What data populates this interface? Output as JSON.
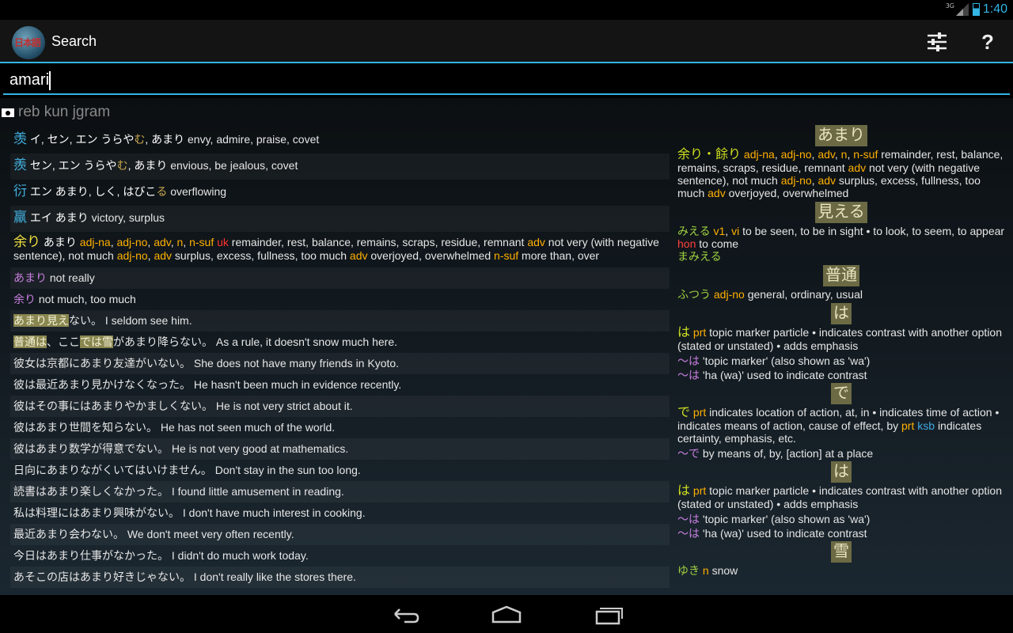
{
  "status": {
    "network": "3G",
    "time": "1:40"
  },
  "app": {
    "logo_text": "日本語",
    "title": "Search",
    "settings_icon": "sliders-icon",
    "help_label": "?"
  },
  "search": {
    "value": "amari"
  },
  "filter": {
    "text": "reb kun jgram"
  },
  "left_rows": {
    "r1": {
      "kanji": "羡",
      "kana": "イ, セン, エン うらや",
      "kana2": "む",
      "kana3": ", あまり",
      "meaning": "envy, admire, praise, covet"
    },
    "r2": {
      "kanji": "羨",
      "kana": "セン, エン うらや",
      "kana2": "む",
      "kana3": ", あまり",
      "meaning": "envious, be jealous, covet"
    },
    "r3": {
      "kanji": "衍",
      "kana": "エン あまり, しく, はびこ",
      "kana2": "る",
      "meaning": "overflowing"
    },
    "r4": {
      "kanji": "羸",
      "kana": "エイ あまり",
      "meaning": "victory, surplus"
    },
    "r5": {
      "word": "余り",
      "reading": "あまり",
      "pos1": "adj-na",
      "pos2": "adj-no",
      "pos3": "adv",
      "pos4": "n",
      "pos5": "n-suf",
      "uk": "uk",
      "m1": "remainder, rest, balance, remains, scraps, residue, remnant",
      "pos6": "adv",
      "m2": "not very (with negative sentence), not much",
      "pos7": "adj-no",
      "pos8": "adv",
      "m3": "surplus, excess, fullness, too much",
      "pos9": "adv",
      "m4": "overjoyed, overwhelmed",
      "pos10": "n-suf",
      "m5": "more than, over"
    },
    "r6": {
      "phrase": "あまり",
      "meaning": "not really"
    },
    "r7": {
      "phrase": "余り",
      "meaning": "not much, too much"
    },
    "r8": {
      "hl1": "あまり",
      "hl2": "見え",
      "jp": "ない。",
      "en": "I seldom see him."
    },
    "r9": {
      "hl1": "普通",
      "hl2": "は",
      "jp1": "、ここ",
      "hl3": "で",
      "hl4": "は",
      "hl5": "雪",
      "jp2": "があまり降らない。",
      "en": "As a rule, it doesn't snow much here."
    },
    "r10": {
      "jp": "彼女は京都にあまり友達がいない。",
      "en": "She does not have many friends in Kyoto."
    },
    "r11": {
      "jp": "彼は最近あまり見かけなくなった。",
      "en": "He hasn't been much in evidence recently."
    },
    "r12": {
      "jp": "彼はその事にはあまりやかましくない。",
      "en": "He is not very strict about it."
    },
    "r13": {
      "jp": "彼はあまり世間を知らない。",
      "en": "He has not seen much of the world."
    },
    "r14": {
      "jp": "彼はあまり数学が得意でない。",
      "en": "He is not very good at mathematics."
    },
    "r15": {
      "jp": "日向にあまりながくいてはいけません。",
      "en": "Don't stay in the sun too long."
    },
    "r16": {
      "jp": "読書はあまり楽しくなかった。",
      "en": "I found little amusement in reading."
    },
    "r17": {
      "jp": "私は料理にはあまり興味がない。",
      "en": "I don't have much interest in cooking."
    },
    "r18": {
      "jp": "最近あまり会わない。",
      "en": "We don't meet very often recently."
    },
    "r19": {
      "jp": "今日はあまり仕事がなかった。",
      "en": "I didn't do much work today."
    },
    "r20": {
      "jp": "あそこの店はあまり好きじゃない。",
      "en": "I don't really like the stores there."
    }
  },
  "right": {
    "h1": "あまり",
    "e1": {
      "word": "余り・餘り",
      "pos1": "adj-na",
      "pos2": "adj-no",
      "pos3": "adv",
      "pos4": "n",
      "pos5": "n-suf",
      "m1": "remainder, rest, balance, remains, scraps, residue, remnant",
      "pos6": "adv",
      "m2": "not very (with negative sentence), not much",
      "pos7": "adj-no",
      "pos8": "adv",
      "m3": "surplus, excess, fullness, too much",
      "pos9": "adv",
      "m4": "overjoyed, overwhelmed"
    },
    "h2": "見える",
    "e2": {
      "word": "みえる",
      "pos1": "v1",
      "pos2": "vi",
      "m1": "to be seen, to be in sight • to look, to seem, to appear",
      "hon": "hon",
      "m2": "to come",
      "alt": "まみえる"
    },
    "h3": "普通",
    "e3": {
      "word": "ふつう",
      "pos1": "adj-no",
      "m1": "general, ordinary, usual"
    },
    "h4": "は",
    "e4": {
      "word": "は",
      "pos1": "prt",
      "m1": "topic marker particle • indicates contrast with another option (stated or unstated) • adds emphasis",
      "p1": "〜は",
      "p1m": "'topic marker' (also shown as 'wa')",
      "p2": "〜は",
      "p2m": "'ha (wa)' used to indicate contrast"
    },
    "h5": "で",
    "e5": {
      "word": "で",
      "pos1": "prt",
      "m1": "indicates location of action, at, in • indicates time of action • indicates means of action, cause of effect, by",
      "pos2": "prt",
      "ksb": "ksb",
      "m2": "indicates certainty, emphasis, etc.",
      "p1": "〜で",
      "p1m": "by means of, by, [action] at a place"
    },
    "h6": "は",
    "e6": {
      "word": "は",
      "pos1": "prt",
      "m1": "topic marker particle • indicates contrast with another option (stated or unstated) • adds emphasis",
      "p1": "〜は",
      "p1m": "'topic marker' (also shown as 'wa')",
      "p2": "〜は",
      "p2m": "'ha (wa)' used to indicate contrast"
    },
    "h7": "雪",
    "e7": {
      "word": "ゆき",
      "pos1": "n",
      "m1": "snow"
    }
  },
  "nav": {
    "back": "back-icon",
    "home": "home-icon",
    "recents": "recents-icon"
  }
}
